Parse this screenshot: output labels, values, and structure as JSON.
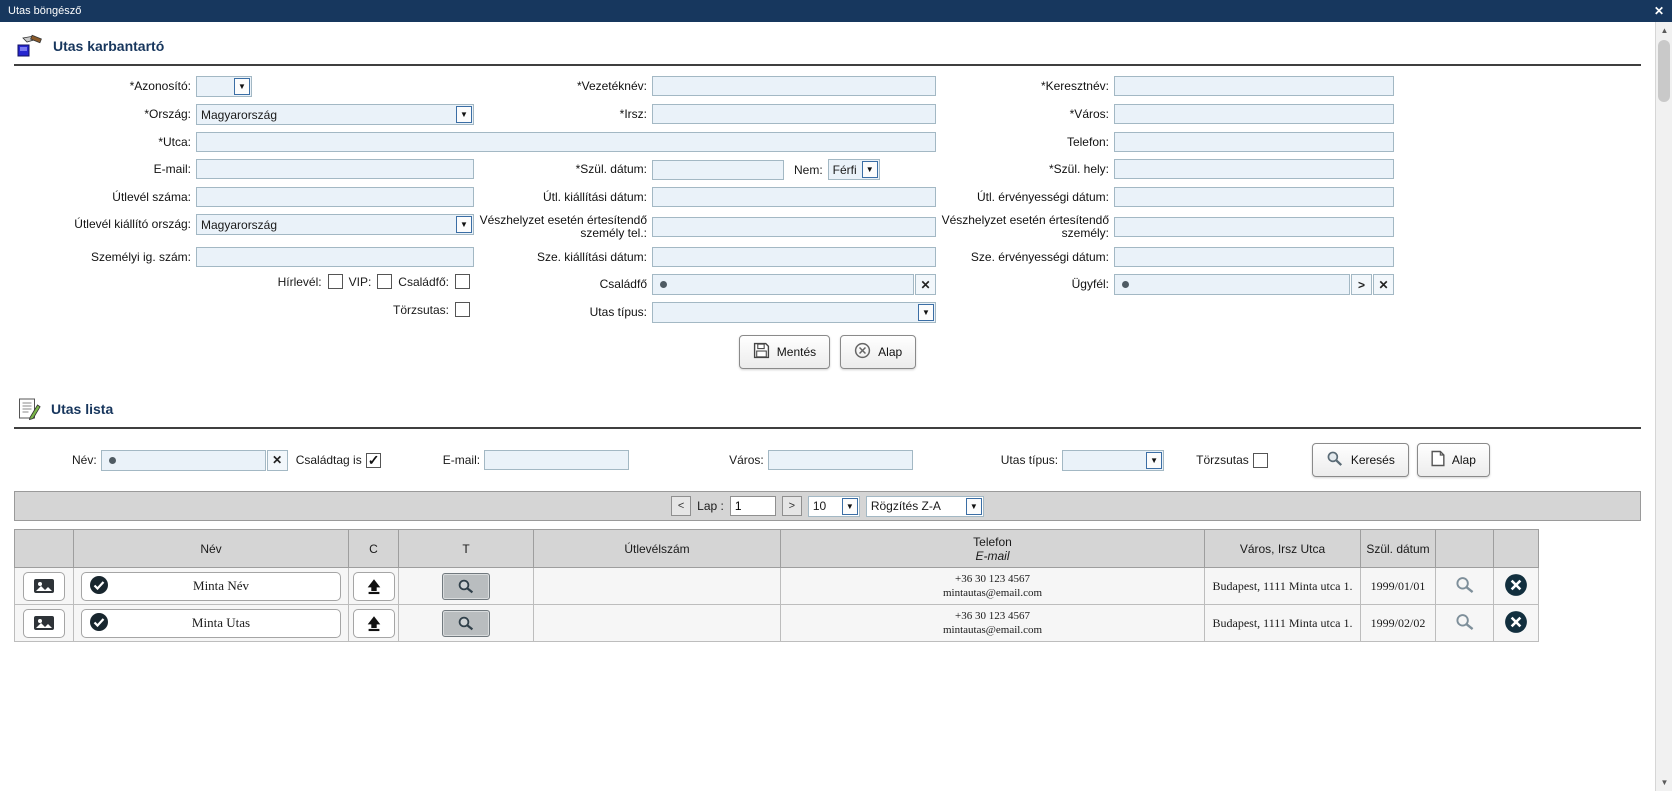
{
  "window": {
    "title": "Utas böngésző",
    "close": "✕"
  },
  "form": {
    "title": "Utas karbantartó",
    "labels": {
      "azonosito": "*Azonosító:",
      "vezeteknev": "*Vezetéknév:",
      "keresztnev": "*Keresztnév:",
      "orszag": "*Ország:",
      "irsz": "*Irsz:",
      "varos": "*Város:",
      "utca": "*Utca:",
      "telefon": "Telefon:",
      "email": "E-mail:",
      "szul_datum": "*Szül. dátum:",
      "nem": "Nem:",
      "szul_hely": "*Szül. hely:",
      "utlevel_szama": "Útlevél száma:",
      "utl_kiallitasi": "Útl. kiállítási dátum:",
      "utl_ervenyessegi": "Útl. érvényességi dátum:",
      "utlevel_kiallito_orszag": "Útlevél kiállító ország:",
      "veszhelyzet_tel": "Vészhelyzet esetén értesítendő személy tel.:",
      "veszhelyzet_szemely": "Vészhelyzet esetén értesítendő személy:",
      "szemelyi_ig_szam": "Személyi ig. szám:",
      "sze_kiallitasi": "Sze. kiállítási dátum:",
      "sze_ervenyessegi": "Sze. érvényességi dátum:",
      "hirlevel": "Hírlevél:",
      "vip": "VIP:",
      "csaladfo_cb": "Családfő:",
      "csaladfo_picker": "Családfő",
      "ugyfel": "Ügyfél:",
      "torzsutas": "Törzsutas:",
      "utas_tipus": "Utas típus:"
    },
    "values": {
      "orszag": "Magyarország",
      "nem": "Férfi",
      "utlevel_kiallito_orszag": "Magyarország"
    },
    "picker_controls": {
      "clear": "✕",
      "open": ">"
    },
    "buttons": {
      "mentes": "Mentés",
      "alap": "Alap"
    }
  },
  "list": {
    "title": "Utas lista",
    "filters": {
      "nev": "Név:",
      "csaladtag": "Családtag is",
      "csaladtag_checked": true,
      "email": "E-mail:",
      "varos": "Város:",
      "utas_tipus": "Utas típus:",
      "torzsutas": "Törzsutas",
      "kereses": "Keresés",
      "alap": "Alap",
      "clear": "✕"
    },
    "pagination": {
      "prev": "<",
      "lap": "Lap :",
      "page": "1",
      "next": ">",
      "page_size": "10",
      "sort": "Rögzítés Z-A"
    },
    "table": {
      "headers": {
        "nev": "Név",
        "c": "C",
        "t": "T",
        "utlevelszam": "Útlevélszám",
        "telefon": "Telefon",
        "email": "E-mail",
        "varos": "Város, Irsz Utca",
        "szul_datum": "Szül. dátum"
      },
      "rows": [
        {
          "name": "Minta Név",
          "phone": "+36 30 123 4567",
          "email": "mintautas@email.com",
          "address": "Budapest, 1111 Minta utca 1.",
          "birth": "1999/01/01"
        },
        {
          "name": "Minta Utas",
          "phone": "+36 30 123 4567",
          "email": "mintautas@email.com",
          "address": "Budapest, 1111 Minta utca 1.",
          "birth": "1999/02/02"
        }
      ]
    }
  },
  "colors": {
    "titlebar": "#17375e",
    "input_bg": "#eaf2f9",
    "table_header_bg": "#d5d5d5"
  }
}
